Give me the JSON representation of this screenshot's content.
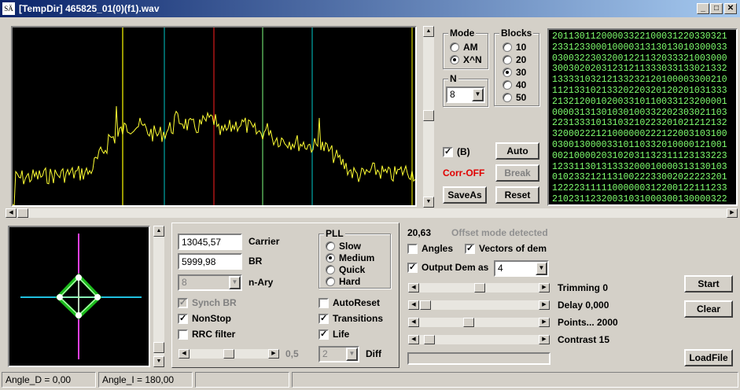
{
  "window": {
    "icon_text": "SÄ",
    "title": "[TempDir] 465825_01(0)(f1).wav",
    "min_label": "_",
    "max_label": "□",
    "close_label": "✕"
  },
  "mode": {
    "label": "Mode",
    "options": [
      {
        "label": "AM",
        "selected": false
      },
      {
        "label": "X^N",
        "selected": true
      }
    ]
  },
  "n_group": {
    "label": "N",
    "value": "8"
  },
  "blocks": {
    "label": "Blocks",
    "options": [
      {
        "label": "10",
        "selected": false
      },
      {
        "label": "20",
        "selected": false
      },
      {
        "label": "30",
        "selected": true
      },
      {
        "label": "40",
        "selected": false
      },
      {
        "label": "50",
        "selected": false
      }
    ]
  },
  "controls_top": {
    "b_checkbox": {
      "label": "(B)",
      "checked": true
    },
    "corr_status": "Corr-OFF",
    "corr_color": "#e00000",
    "auto_label": "Auto",
    "break_label": "Break",
    "saveas_label": "SaveAs",
    "reset_label": "Reset"
  },
  "data_text": [
    "20113011200003322100031220330321",
    "23312330001000031313013010300033",
    "03003223032001221132033321003000",
    "30030202031231211333033133021332",
    "13333103212133232120100003300210",
    "11213310213320220320120201031333",
    "21321200102003310110033123200001",
    "00003131301030100332202303021103",
    "22313331013103210223201021212132",
    "32000222121000000222122003103100",
    "03001300003310110332010000121001",
    "00210000203102031132311123133223",
    "12331130131333200010000313130103",
    "01023321211310022233002022223201",
    "12222311111000000312200122111233",
    "21023112320031031000300130000322",
    "00321"
  ],
  "fields": {
    "carrier_value": "13045,57",
    "carrier_label": "Carrier",
    "br_value": "5999,98",
    "br_label": "BR",
    "nary_value": "8",
    "nary_label": "n-Ary"
  },
  "pll": {
    "label": "PLL",
    "options": [
      {
        "label": "Slow",
        "selected": false
      },
      {
        "label": "Medium",
        "selected": true
      },
      {
        "label": "Quick",
        "selected": false
      },
      {
        "label": "Hard",
        "selected": false
      }
    ]
  },
  "checks": {
    "synch_br": {
      "label": "Synch BR",
      "checked": true
    },
    "nonstop": {
      "label": "NonStop",
      "checked": true
    },
    "rrc_filter": {
      "label": "RRC filter",
      "checked": false
    },
    "autoreset": {
      "label": "AutoReset",
      "checked": false
    },
    "transitions": {
      "label": "Transitions",
      "checked": true
    },
    "life": {
      "label": "Life",
      "checked": true
    },
    "angles": {
      "label": "Angles",
      "checked": false
    },
    "vectors_of_dem": {
      "label": "Vectors of dem",
      "checked": true
    },
    "output_dem": {
      "label": "Output Dem as",
      "checked": true
    }
  },
  "rrc_slider_value": "0,5",
  "diff": {
    "value": "2",
    "label": "Diff"
  },
  "offset": {
    "value": "20,63",
    "message": "Offset mode detected"
  },
  "output_dem_value": "4",
  "sliders": {
    "trimming": "Trimming 0",
    "delay": "Delay  0,000",
    "points": "Points... 2000",
    "contrast": "Contrast 15"
  },
  "buttons": {
    "start": "Start",
    "clear": "Clear",
    "loadfile": "LoadFile"
  },
  "status": {
    "angle_d": "Angle_D = 0,00",
    "angle_i": "Angle_I = 180,00"
  },
  "colors": {
    "spectrum_trace": "#ffff33",
    "marker_yellow": "#ffff00",
    "marker_cyan": "#00c8c8",
    "marker_red": "#ff2020",
    "marker_green": "#80ff80",
    "constellation_green": "#22dd22",
    "constellation_axis_v": "#e040e0",
    "constellation_axis_h": "#20c0e0"
  }
}
